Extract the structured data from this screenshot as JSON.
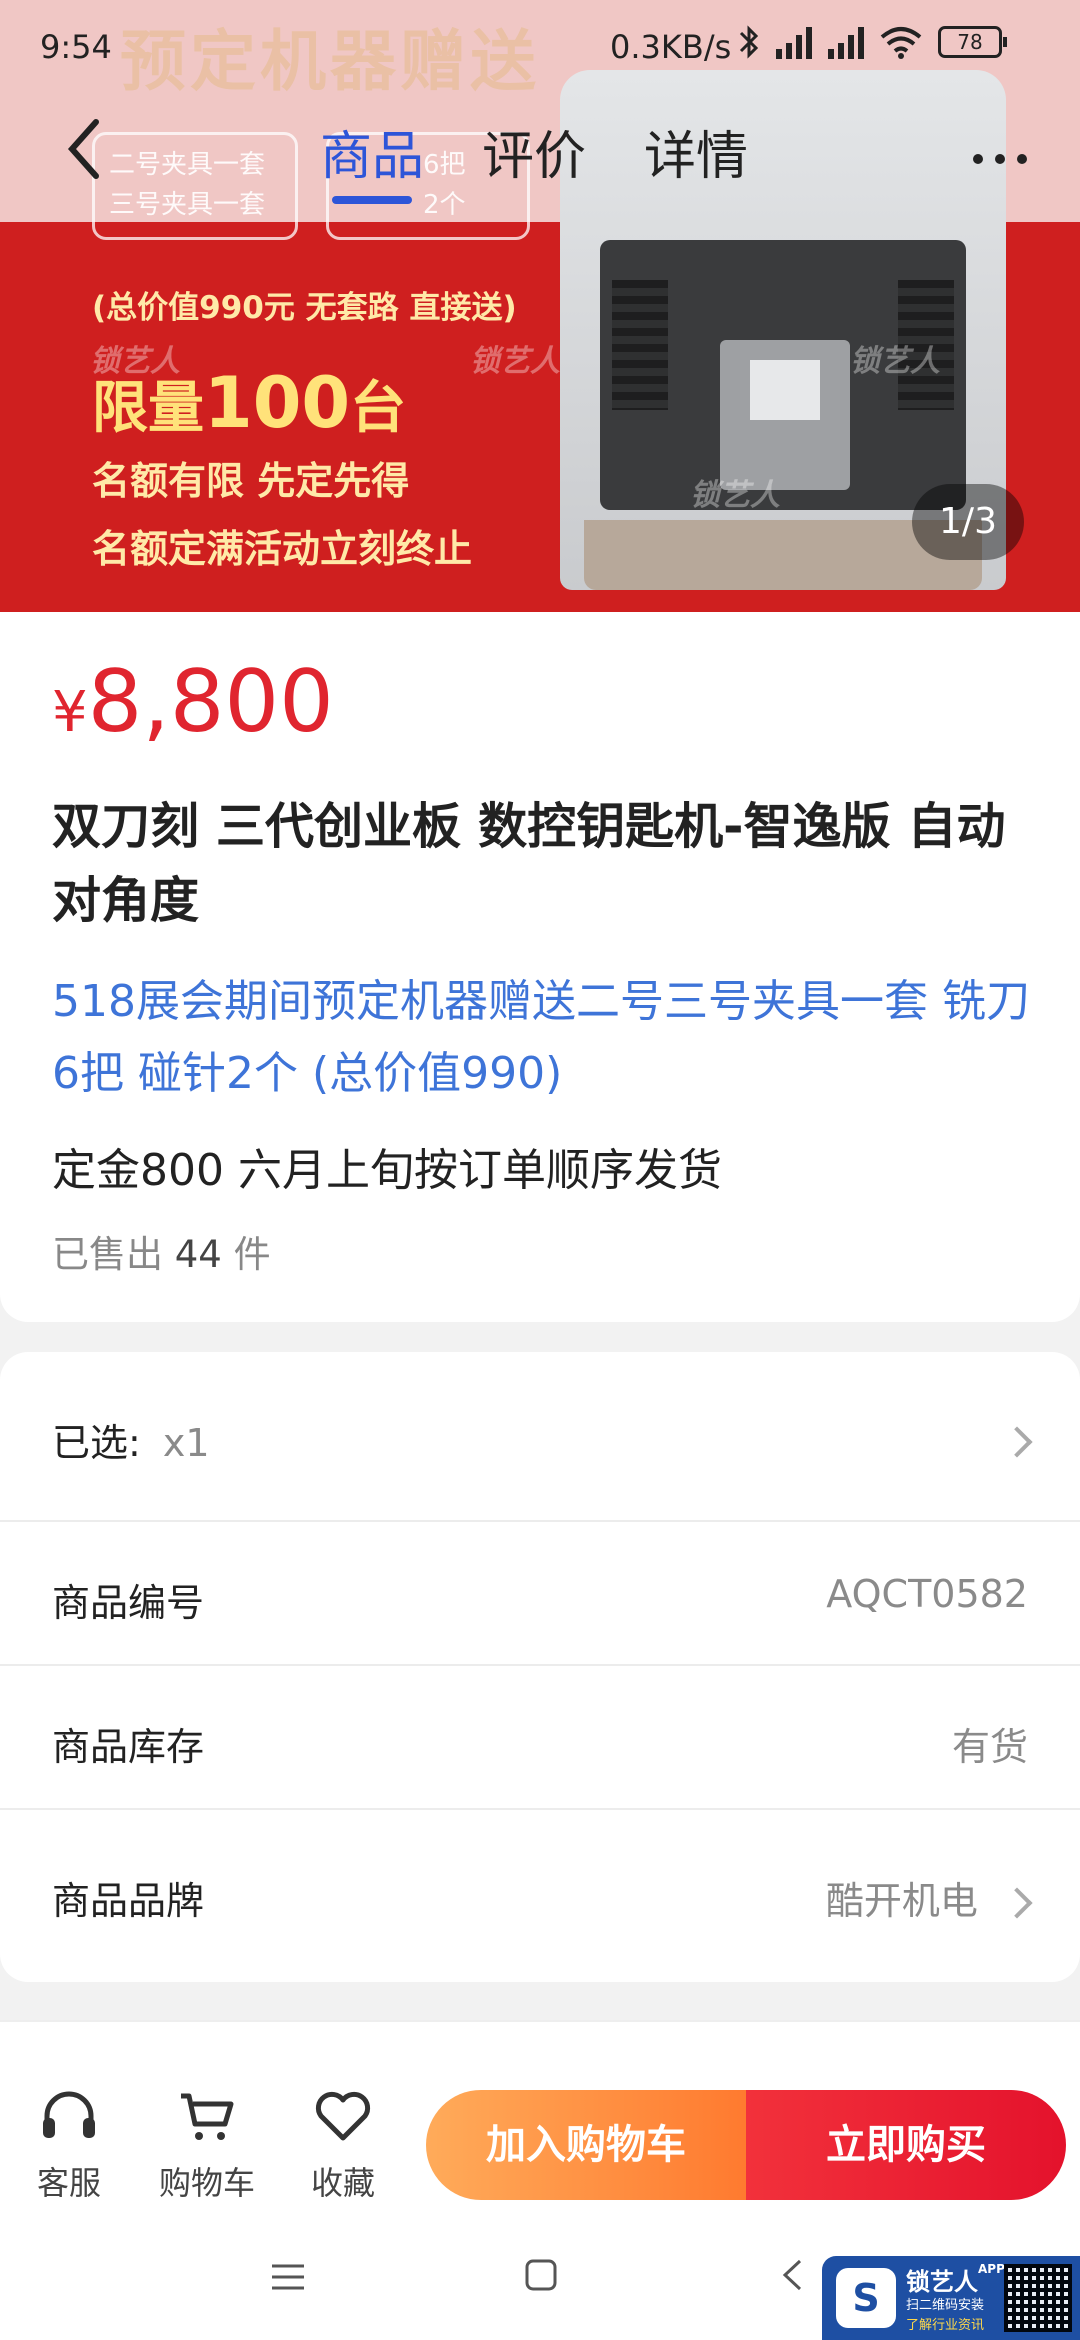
{
  "status_bar": {
    "time": "9:54",
    "net_speed": "0.3KB/s",
    "battery": "78"
  },
  "banner": {
    "headline": "预定机器赠送",
    "gift_left": [
      "二号夹具一套",
      "三号夹具一套"
    ],
    "gift_right": [
      "6把",
      "2个"
    ],
    "total_line": "(总价值990元  无套路  直接送)",
    "limit_prefix": "限量",
    "limit_number": "100",
    "limit_suffix": "台",
    "line_quota": "名额有限 先定先得",
    "line_end": "名额定满活动立刻终止",
    "watermark": "锁艺人",
    "page_counter": "1/3"
  },
  "nav": {
    "tabs": [
      {
        "label": "商品",
        "active": true
      },
      {
        "label": "评价",
        "active": false
      },
      {
        "label": "详情",
        "active": false
      }
    ]
  },
  "product": {
    "currency": "¥",
    "price": "8,800",
    "title": "双刀刻 三代创业板 数控钥匙机-智逸版 自动对角度",
    "promo": "518展会期间预定机器赠送二号三号夹具一套 铣刀6把 碰针2个 (总价值990)",
    "deposit_note": "定金800  六月上旬按订单顺序发货",
    "sold_prefix": "已售出",
    "sold_count": "44",
    "sold_unit": "件"
  },
  "specs": {
    "selected_label": "已选:",
    "selected_value": "x1",
    "code_label": "商品编号",
    "code_value": "AQCT0582",
    "stock_label": "商品库存",
    "stock_value": "有货",
    "brand_label": "商品品牌",
    "brand_value": "酷开机电"
  },
  "action_bar": {
    "service": "客服",
    "cart": "购物车",
    "favorite": "收藏",
    "add_to_cart": "加入购物车",
    "buy_now": "立即购买"
  },
  "app_promo": {
    "name": "锁艺人",
    "superscript": "APP",
    "line1": "扫二维码安装",
    "line2": "了解行业资讯"
  }
}
